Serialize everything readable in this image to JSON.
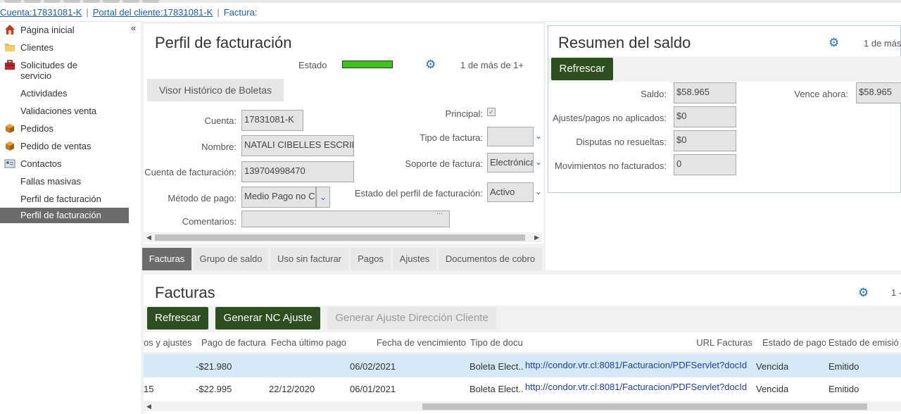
{
  "breadcrumb": {
    "account": "Cuenta:17831081-K",
    "portal": "Portal del cliente:17831081-K",
    "current": "Factura:"
  },
  "sidebar": {
    "collapse": "«",
    "items": [
      {
        "label": "Página inicial",
        "icon": "home-icon"
      },
      {
        "label": "Clientes",
        "icon": "folder-icon"
      },
      {
        "label": "Solicitudes de servicio",
        "icon": "toolbox-icon"
      },
      {
        "label": "Actividades",
        "icon": ""
      },
      {
        "label": "Validaciones venta",
        "icon": ""
      },
      {
        "label": "Pedidos",
        "icon": "order-icon"
      },
      {
        "label": "Pedido de ventas",
        "icon": "order-icon"
      },
      {
        "label": "Contactos",
        "icon": "contact-card-icon"
      },
      {
        "label": "Fallas masivas",
        "icon": ""
      },
      {
        "label": "Perfil de facturación",
        "icon": ""
      },
      {
        "label": "Perfil de facturación",
        "icon": "",
        "active": true
      }
    ]
  },
  "profile": {
    "title": "Perfil de facturación",
    "estado_label": "Estado",
    "estado_color": "#3ec31a",
    "pager": "1 de más de 1+",
    "history_button": "Visor Histórico de Boletas",
    "fields": {
      "cuenta_label": "Cuenta:",
      "cuenta_value": "17831081-K",
      "nombre_label": "Nombre:",
      "nombre_value": "NATALI CIBELLES ESCRIBA",
      "cuenta_fact_label": "Cuenta de facturación:",
      "cuenta_fact_value": "139704998470",
      "metodo_label": "Método de pago:",
      "metodo_value": "Medio Pago no C",
      "comentarios_label": "Comentarios:",
      "comentarios_value": "",
      "principal_label": "Principal:",
      "tipo_label": "Tipo de factura:",
      "tipo_value": "",
      "soporte_label": "Soporte de factura:",
      "soporte_value": "Electrónica",
      "estado_perfil_label": "Estado del perfil de facturación:",
      "estado_perfil_value": "Activo"
    }
  },
  "balance": {
    "title": "Resumen del saldo",
    "pager": "1 de más",
    "refresh": "Refrescar",
    "saldo_label": "Saldo:",
    "saldo_value": "$58.965",
    "vence_label": "Vence ahora:",
    "vence_value": "$58.965",
    "ajustes_label": "Ajustes/pagos no aplicados:",
    "ajustes_value": "$0",
    "disputas_label": "Disputas no resueltas:",
    "disputas_value": "$0",
    "movimientos_label": "Movimientos no facturados:",
    "movimientos_value": "0"
  },
  "tabs": [
    "Facturas",
    "Grupo de saldo",
    "Uso sin facturar",
    "Pagos",
    "Ajustes",
    "Documentos de cobro"
  ],
  "invoices": {
    "title": "Facturas",
    "pager": "1 -",
    "refresh": "Refrescar",
    "generate_nc": "Generar NC Ajuste",
    "generate_dir": "Generar Ajuste Dirección Cliente",
    "columns": [
      "os y ajustes",
      "Pago de factura",
      "Fecha último pago",
      "Fecha de vencimiento",
      "Tipo de docu",
      "URL Facturas",
      "Estado de pago",
      "Estado de emisió"
    ],
    "rows": [
      {
        "ajustes": "",
        "pago": "-$21.980",
        "ultimo": "",
        "vencimiento": "06/02/2021",
        "tipo": "Boleta Elect...",
        "url": "http://condor.vtr.cl:8081/Facturacion/PDFServlet?docId",
        "estado_pago": "Vencida",
        "emision": "Emitido"
      },
      {
        "ajustes": "15",
        "pago": "-$22.995",
        "ultimo": "22/12/2020",
        "vencimiento": "06/01/2021",
        "tipo": "Boleta Elect...",
        "url": "http://condor.vtr.cl:8081/Facturacion/PDFServlet?docId",
        "estado_pago": "Vencida",
        "emision": "Emitido"
      }
    ]
  }
}
